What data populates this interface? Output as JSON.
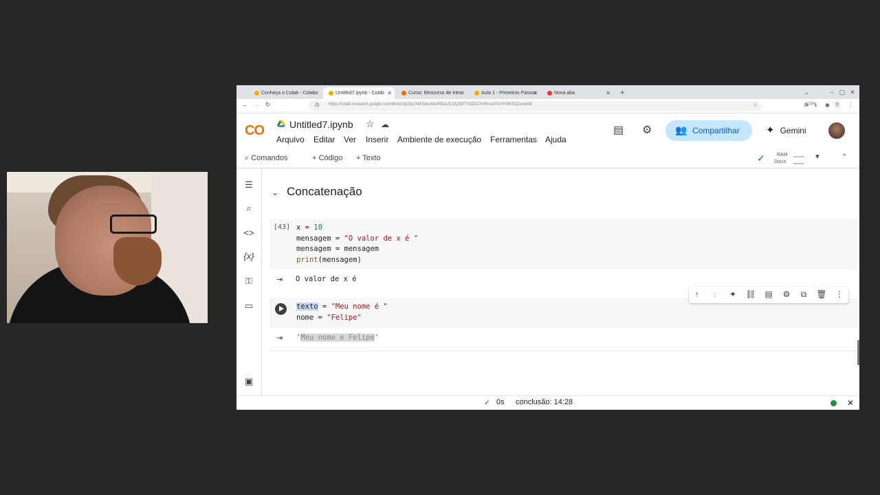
{
  "browser": {
    "tabs": [
      {
        "label": "Conheça o Colab - Colab",
        "favicon_color": "#f9ab00"
      },
      {
        "label": "Untitled7.ipynb - Colab",
        "favicon_color": "#f9ab00"
      },
      {
        "label": "Curso: Minicurso de Intro",
        "favicon_color": "#e8710a"
      },
      {
        "label": "Aula 1 - Primeiros Passos",
        "favicon_color": "#f9ab00"
      },
      {
        "label": "Nova aba",
        "favicon_color": "#e53935"
      }
    ],
    "new_tab": "+",
    "window_controls": [
      "⌄",
      "–",
      "▢",
      "✕"
    ],
    "url": "https://colab.research.google.com/drive/1lg1tpJXM7peu4AdRDaLfLQQG8TY3D1CYxRccc0Tcr4YBK5QDuvqN5",
    "zoom": "170%"
  },
  "colab": {
    "logo": "CO",
    "file_title": "Untitled7.ipynb",
    "menu": [
      "Arquivo",
      "Editar",
      "Ver",
      "Inserir",
      "Ambiente de execução",
      "Ferramentas",
      "Ajuda"
    ],
    "share_label": "Compartilhar",
    "gemini_label": "Gemini",
    "toolbar": {
      "commands": "Comandos",
      "add_code": "+ Código",
      "add_text": "+ Texto",
      "ram": "RAM",
      "disk": "Disco"
    },
    "section_title": "Concatenação",
    "cell1": {
      "exec_count": "[43]",
      "lines": [
        [
          "x = ",
          "10"
        ],
        [
          "mensagem = ",
          "\"O valor de x é \""
        ],
        [
          "mensagem = mensagem",
          ""
        ],
        [
          "print",
          "(mensagem)"
        ]
      ],
      "output": "O valor de x é"
    },
    "cell2": {
      "line1_var": "texto",
      "line1_rest": " = ",
      "line1_str": "\"Meu nome é \"",
      "line2_code": "nome = ",
      "line2_str": "\"Felipe\"",
      "output_quote_open": "'",
      "output_text": "Meu nome e Felipe",
      "output_quote_close": "'"
    },
    "status": {
      "time": "0s",
      "completion": "conclusão: 14:28"
    }
  },
  "colors": {
    "accent": "#0b57d0",
    "share_bg": "#c2e7ff",
    "logo_orange": "#f9ab00",
    "status_green": "#1e8e3e"
  }
}
